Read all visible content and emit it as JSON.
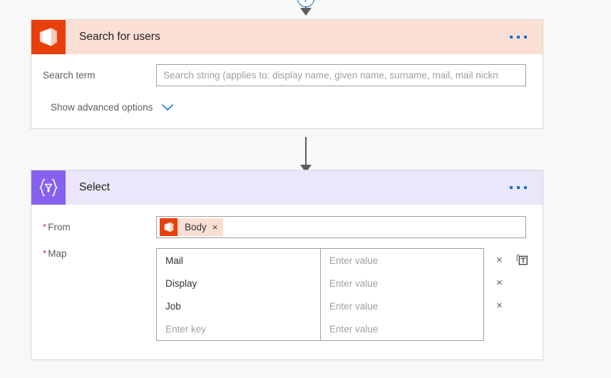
{
  "canvas": {
    "background_color": "#f8f8f8"
  },
  "connectors": {
    "top": {
      "add_button_label": "+",
      "add_button_name": "insert-step-button"
    },
    "middle": {
      "arrow_name": "flow-arrow"
    }
  },
  "cards": [
    {
      "id": "search-for-users",
      "title": "Search for users",
      "icon": "office-365-icon",
      "header_color": "#fbdfd5",
      "icon_color": "#e8400c",
      "menu_label": "...",
      "fields": [
        {
          "label": "Search term",
          "placeholder": "Search string (applies to: display name, given name, surname, mail, mail nickn",
          "value": ""
        }
      ],
      "advanced_toggle": {
        "label": "Show advanced options",
        "icon": "chevron-down-icon",
        "icon_color": "#1673d4"
      }
    },
    {
      "id": "select",
      "title": "Select",
      "icon": "select-filter-icon",
      "header_color": "#ebe6fa",
      "icon_color": "#8661f0",
      "menu_label": "...",
      "from_field": {
        "label": "From",
        "required_marker": "*",
        "token": {
          "text": "Body",
          "icon": "office-365-icon",
          "remove_label": "×"
        }
      },
      "map_field": {
        "label": "Map",
        "required_marker": "*",
        "key_placeholder": "Enter key",
        "value_placeholder": "Enter value",
        "rows": [
          {
            "key": "Mail",
            "key_is_placeholder": false,
            "value": "Enter value",
            "value_is_placeholder": true,
            "has_delete": true,
            "has_paste": true
          },
          {
            "key": "Display",
            "key_is_placeholder": false,
            "value": "Enter value",
            "value_is_placeholder": true,
            "has_delete": true,
            "has_paste": false
          },
          {
            "key": "Job",
            "key_is_placeholder": false,
            "value": "Enter value",
            "value_is_placeholder": true,
            "has_delete": true,
            "has_paste": false
          },
          {
            "key": "Enter key",
            "key_is_placeholder": true,
            "value": "Enter value",
            "value_is_placeholder": true,
            "has_delete": false,
            "has_paste": false
          }
        ],
        "delete_label": "×",
        "paste_icon": "paste-text-icon"
      }
    }
  ]
}
